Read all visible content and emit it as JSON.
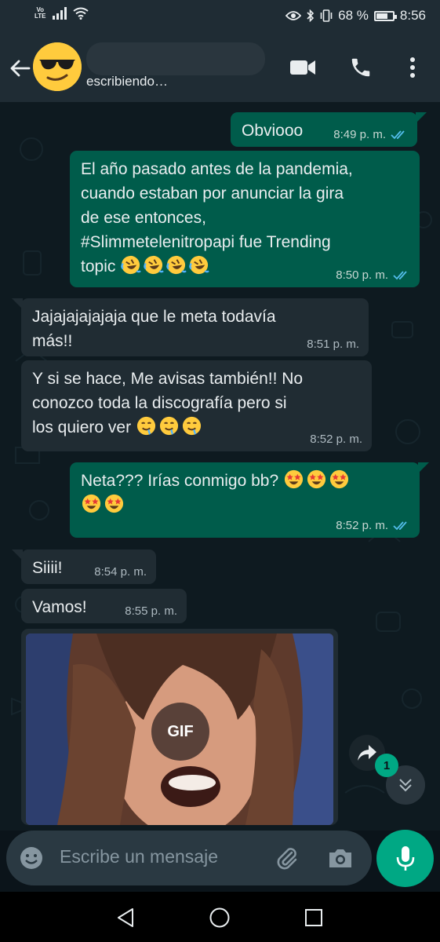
{
  "statusbar": {
    "volte_top": "Vo",
    "volte_bottom": "LTE",
    "battery_percent": "68 %",
    "battery_level": 0.68,
    "time": "8:56"
  },
  "header": {
    "status": "escribiendo…",
    "icons": [
      "back-arrow-icon",
      "video-call-icon",
      "phone-icon",
      "more-options-icon"
    ]
  },
  "messages": [
    {
      "dir": "out",
      "text": "Obviooo",
      "time": "8:49 p. m.",
      "read": true
    },
    {
      "dir": "out",
      "lines": [
        "El año pasado antes de la pandemia,",
        "cuando estaban por anunciar la gira",
        "de ese entonces,",
        "#Slimmetelenitropapi fue Trending"
      ],
      "last_line": "topic",
      "emoji": "rolling-laughing-emoji",
      "emoji_count": 4,
      "time": "8:50 p. m.",
      "read": true
    },
    {
      "dir": "in",
      "lines": [
        "Jajajajajajaja que le meta todavía",
        "más!!"
      ],
      "time": "8:51 p. m."
    },
    {
      "dir": "in",
      "lines": [
        "Y si se hace, Me avisas también!! No",
        "conozco toda la discografía pero si"
      ],
      "last_line": "los quiero ver",
      "emoji": "drooling-face-emoji",
      "emoji_count": 3,
      "time": "8:52 p. m."
    },
    {
      "dir": "out",
      "text": "Neta??? Irías conmigo bb?",
      "emoji": "star-struck-emoji",
      "emoji_count": 5,
      "time": "8:52 p. m.",
      "read": true
    },
    {
      "dir": "in",
      "text": "Siiii!",
      "time": "8:54 p. m."
    },
    {
      "dir": "in",
      "text": "Vamos!",
      "time": "8:55 p. m."
    }
  ],
  "gif": {
    "label": "GIF"
  },
  "unread_badge": "1",
  "composer": {
    "placeholder": "Escribe un mensaje"
  },
  "colors": {
    "outgoing_bubble": "#005c4b",
    "incoming_bubble": "#202c33",
    "accent": "#00a884",
    "read_ticks": "#53bdeb"
  }
}
